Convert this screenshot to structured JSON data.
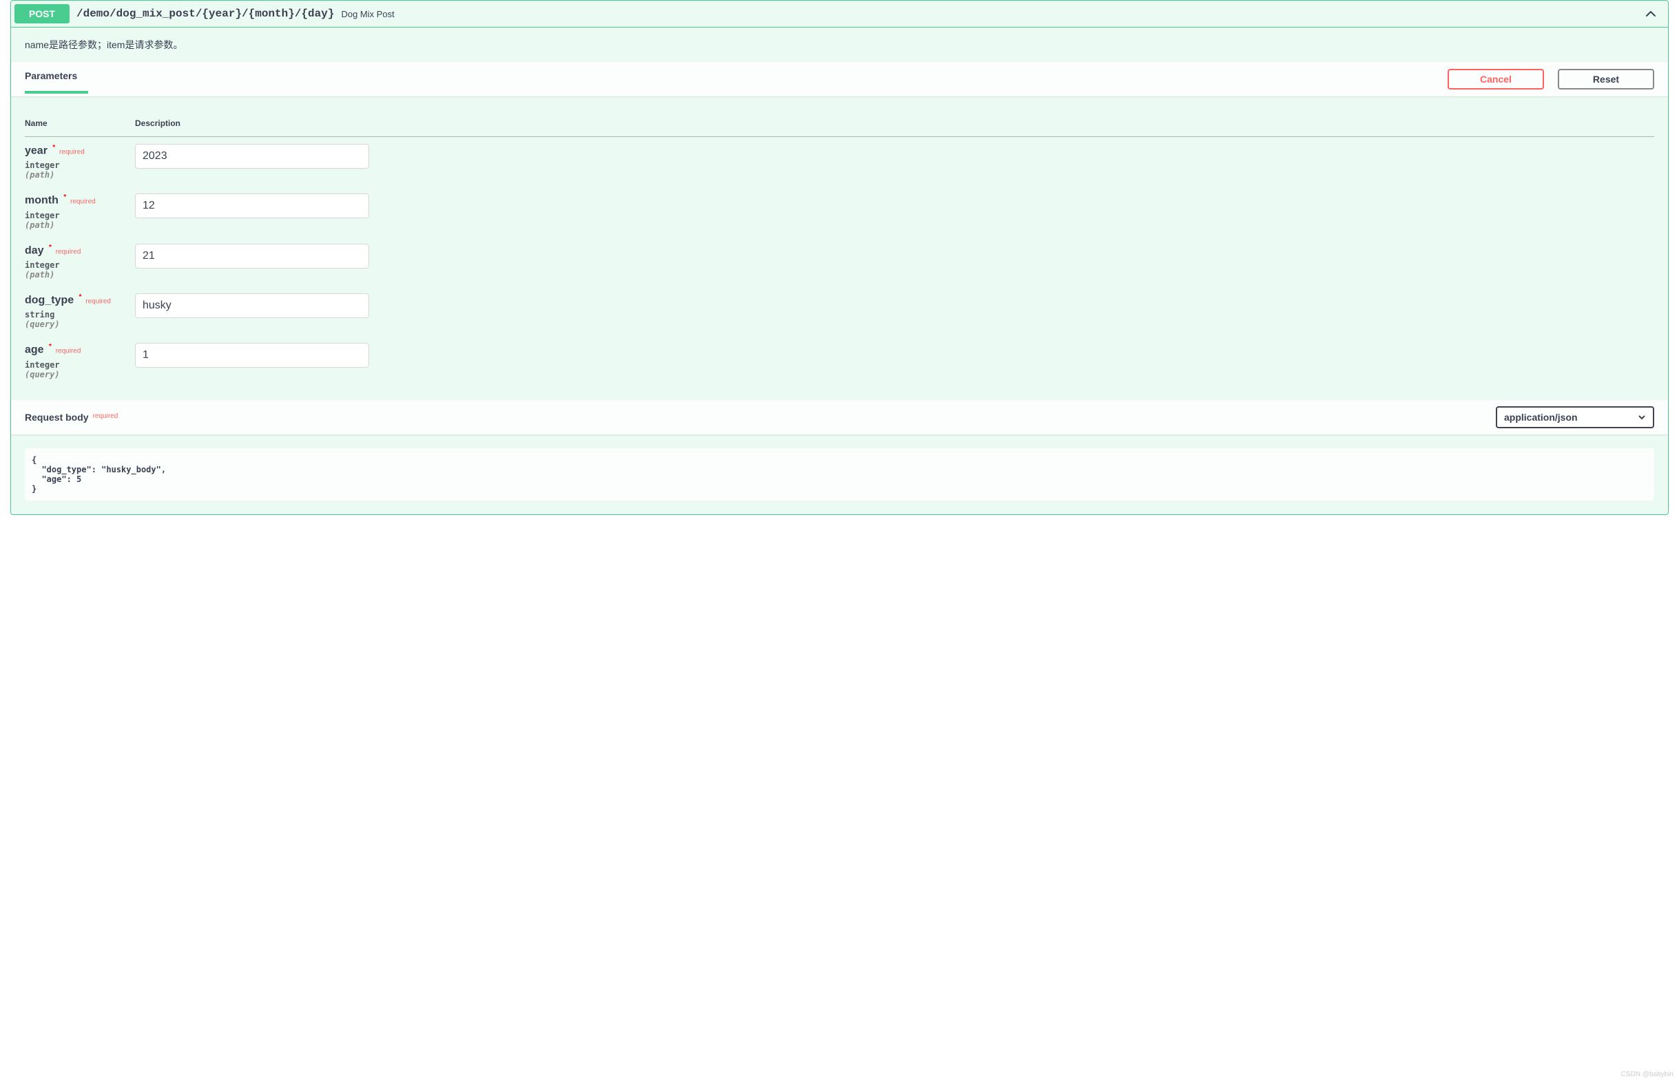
{
  "summary": {
    "method": "POST",
    "path": "/demo/dog_mix_post/{year}/{month}/{day}",
    "description": "Dog Mix Post"
  },
  "description": "name是路径参数；item是请求参数。",
  "section": {
    "parameters_tab": "Parameters",
    "cancel": "Cancel",
    "reset": "Reset"
  },
  "table": {
    "col_name": "Name",
    "col_desc": "Description"
  },
  "params": [
    {
      "name": "year",
      "required": "required",
      "type": "integer",
      "in": "(path)",
      "value": "2023"
    },
    {
      "name": "month",
      "required": "required",
      "type": "integer",
      "in": "(path)",
      "value": "12"
    },
    {
      "name": "day",
      "required": "required",
      "type": "integer",
      "in": "(path)",
      "value": "21"
    },
    {
      "name": "dog_type",
      "required": "required",
      "type": "string",
      "in": "(query)",
      "value": "husky"
    },
    {
      "name": "age",
      "required": "required",
      "type": "integer",
      "in": "(query)",
      "value": "1"
    }
  ],
  "request_body": {
    "title": "Request body",
    "required": "required",
    "content_type": "application/json",
    "payload": "{\n  \"dog_type\": \"husky_body\",\n  \"age\": 5\n}"
  },
  "watermark": "CSDN @babybin"
}
